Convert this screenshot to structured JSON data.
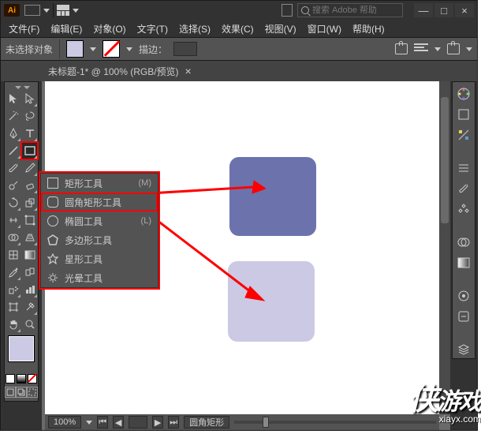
{
  "titlebar": {
    "badge": "Ai",
    "search_placeholder": "搜索 Adobe 帮助"
  },
  "win": {
    "min": "—",
    "max": "□",
    "close": "×"
  },
  "menu": {
    "file": "文件(F)",
    "edit": "编辑(E)",
    "object": "对象(O)",
    "type": "文字(T)",
    "select": "选择(S)",
    "effect": "效果(C)",
    "view": "视图(V)",
    "window": "窗口(W)",
    "help": "帮助(H)"
  },
  "ctrl": {
    "no_selection": "未选择对象",
    "stroke_label": "描边：",
    "stroke_weight": ""
  },
  "tab": {
    "title": "未标题-1* @ 100% (RGB/预览)",
    "close": "×"
  },
  "flyout": {
    "items": [
      {
        "label": "矩形工具",
        "shortcut": "(M)"
      },
      {
        "label": "圆角矩形工具",
        "shortcut": ""
      },
      {
        "label": "椭圆工具",
        "shortcut": "(L)"
      },
      {
        "label": "多边形工具",
        "shortcut": ""
      },
      {
        "label": "星形工具",
        "shortcut": ""
      },
      {
        "label": "光晕工具",
        "shortcut": ""
      }
    ]
  },
  "status": {
    "zoom": "100%",
    "tool": "圆角矩形"
  },
  "watermark": {
    "main": "侠",
    "sub1": "游戏",
    "url": "xiayx.com"
  }
}
